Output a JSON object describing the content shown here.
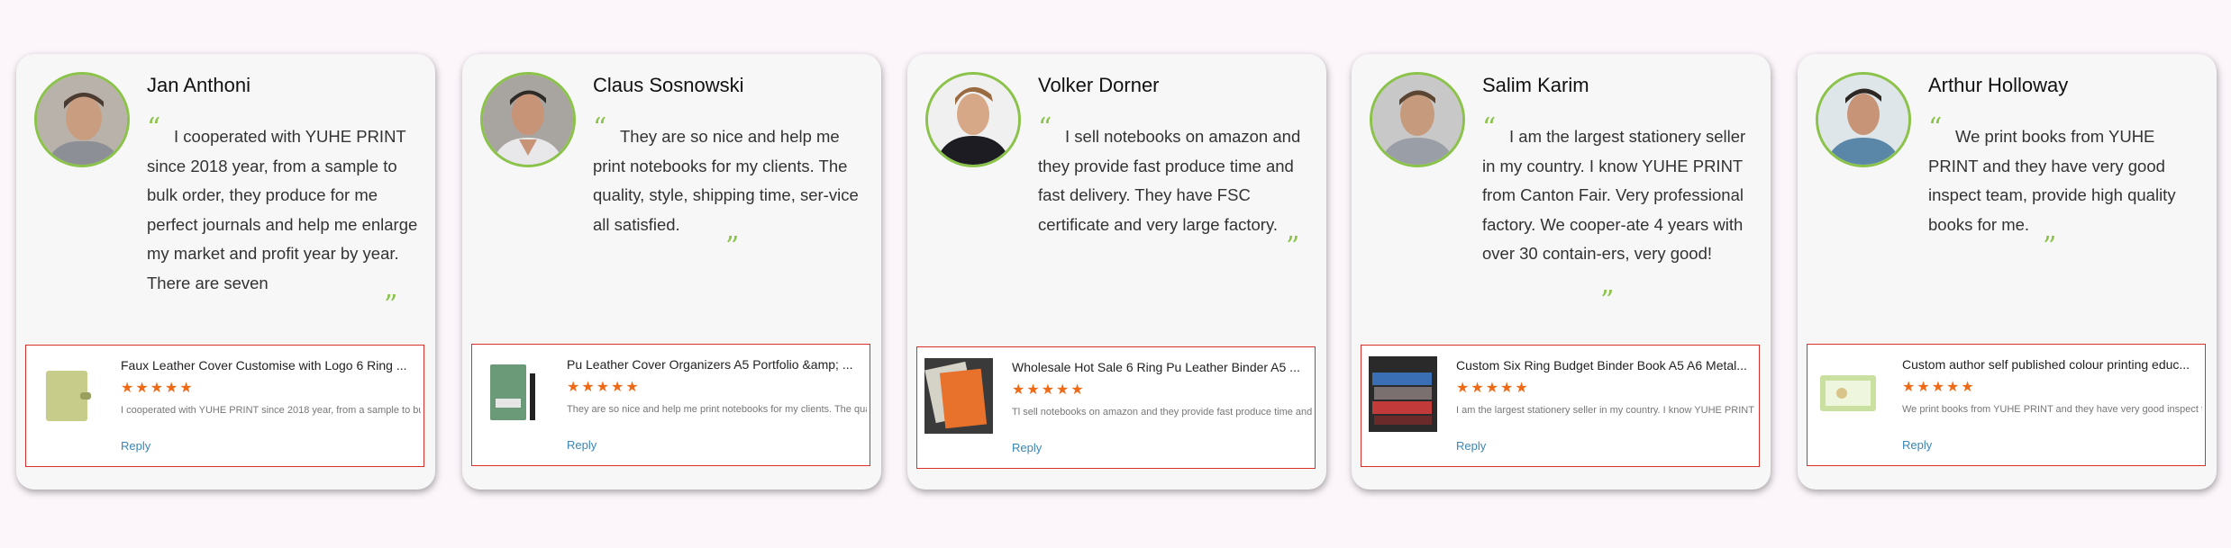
{
  "testimonials": [
    {
      "name": "Jan Anthoni",
      "review": "I cooperated with YUHE PRINT since 2018 year, from a sample to bulk order, they produce for me perfect journals and help me enlarge my market and profit year by year. There are seven",
      "product_title": "Faux Leather Cover Customise with Logo 6 Ring ...",
      "stars": "★★★★★",
      "excerpt": "I cooperated with YUHE PRINT since 2018 year, from a sample to bu",
      "reply": "Reply",
      "product_color": "#c8cc8a"
    },
    {
      "name": "Claus Sosnowski",
      "review": "They are so nice and help me print notebooks for my clients. The quality, style, shipping time, ser-vice all satisfied.",
      "product_title": "Pu Leather Cover Organizers A5 Portfolio &amp; ...",
      "stars": "★★★★★",
      "excerpt": "They are so nice and help me print notebooks for my clients. The qua",
      "reply": "Reply",
      "product_color": "#6b9a78"
    },
    {
      "name": "Volker Dorner",
      "review": "I sell notebooks on amazon and they provide fast produce time and fast delivery. They have FSC certificate and very large factory.",
      "product_title": "Wholesale Hot Sale 6 Ring Pu Leather Binder A5 ...",
      "stars": "★★★★★",
      "excerpt": "Tl sell notebooks on amazon and they provide fast produce time and",
      "reply": "Reply",
      "product_color": "#e8722c"
    },
    {
      "name": "Salim Karim",
      "review": "I am the largest stationery seller in my country. I know YUHE PRINT from Canton Fair. Very professional factory. We cooper-ate 4 years with over 30 contain-ers, very good!",
      "product_title": "Custom Six Ring Budget Binder Book A5 A6 Metal...",
      "stars": "★★★★★",
      "excerpt": "I am the largest stationery seller in my country. I know YUHE PRINT",
      "reply": "Reply",
      "product_color": "#3a6fb5"
    },
    {
      "name": "Arthur Holloway",
      "review": "We print books from YUHE PRINT and they have very good inspect team, provide high quality books for me.",
      "product_title": "Custom author self published colour printing educ...",
      "stars": "★★★★★",
      "excerpt": "We print books from YUHE PRINT and they have very good inspect t",
      "reply": "Reply",
      "product_color": "#c9e0a0"
    }
  ],
  "quote_open": "“",
  "quote_close": "”",
  "colors": {
    "accent_green": "#8bc34a",
    "star_orange": "#ef6a16",
    "border_red": "#d9302c",
    "reply_blue": "#3a86b7"
  },
  "icons": [
    "avatar",
    "product-thumbnail",
    "star-icon"
  ]
}
